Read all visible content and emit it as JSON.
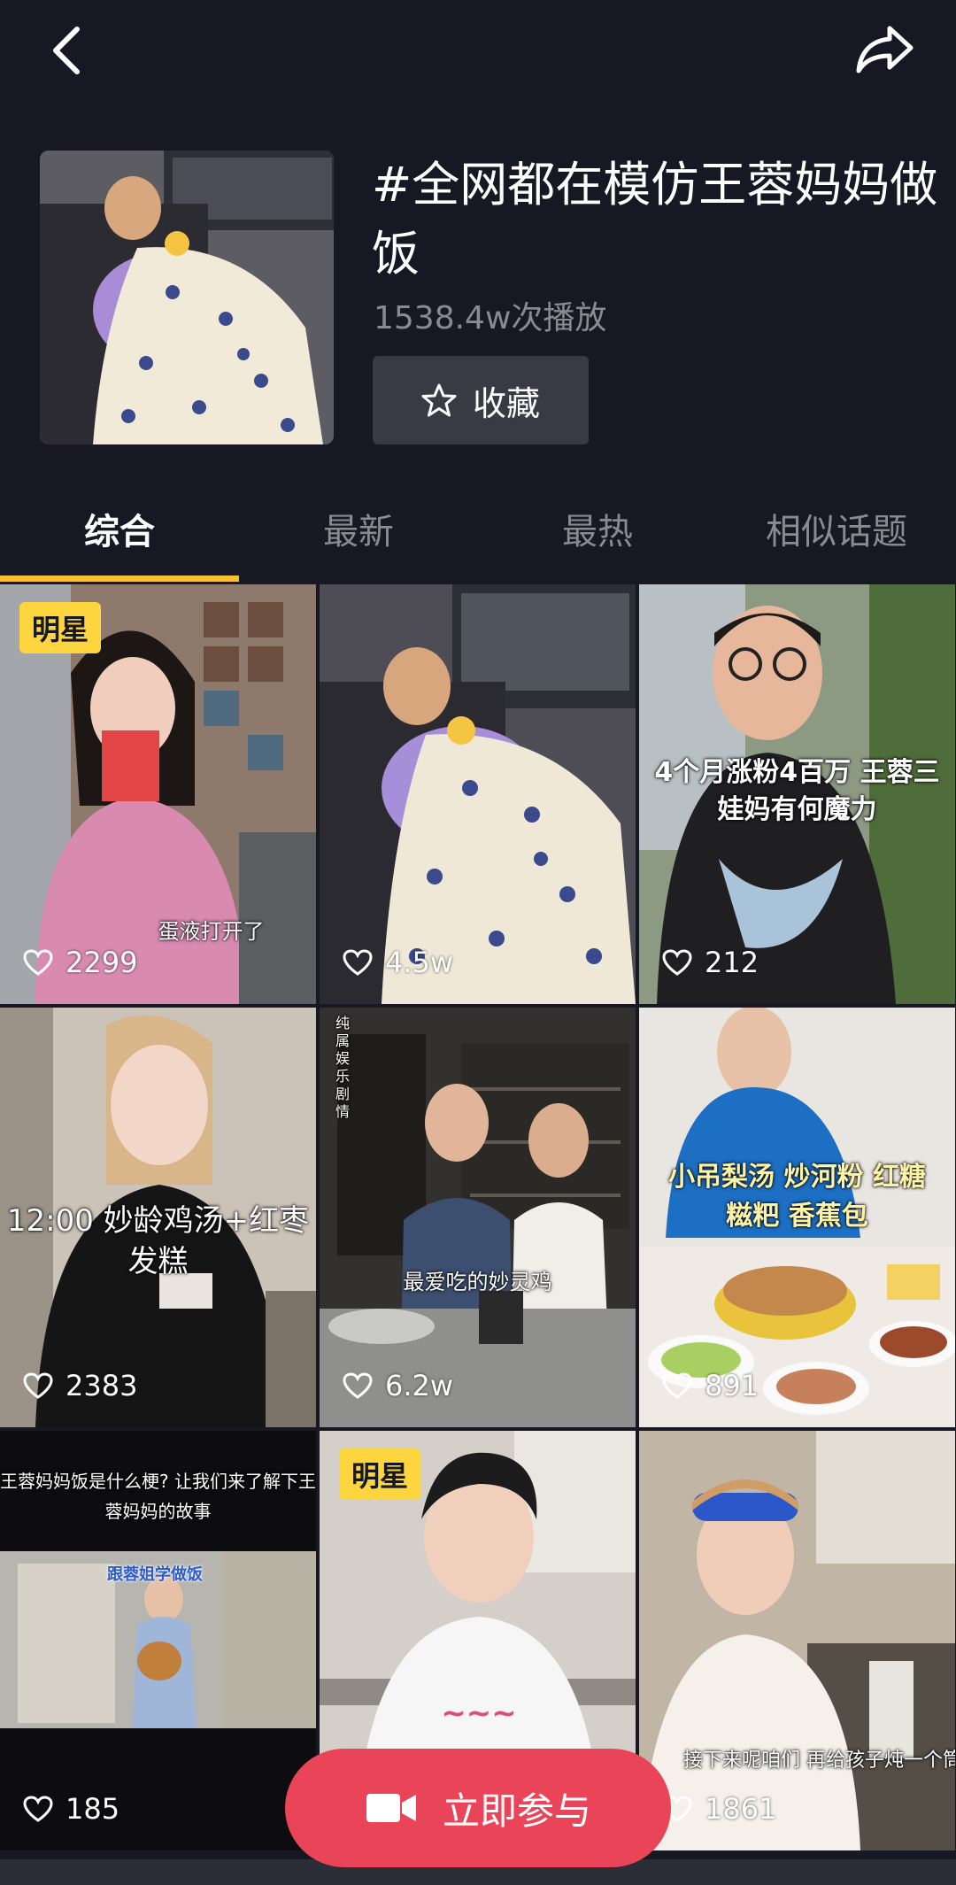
{
  "topbar": {
    "back_icon": "chevron-left-icon",
    "share_icon": "share-arrow-icon"
  },
  "topic": {
    "title": "#全网都在模仿王蓉妈妈做饭",
    "plays": "1538.4w次播放",
    "favorite_label": "收藏"
  },
  "tabs": [
    {
      "label": "综合",
      "active": true
    },
    {
      "label": "最新",
      "active": false
    },
    {
      "label": "最热",
      "active": false
    },
    {
      "label": "相似话题",
      "active": false
    }
  ],
  "videos": [
    {
      "likes": "2299",
      "badge": "明星",
      "caption": "蛋液打开了"
    },
    {
      "likes": "4.5w",
      "badge": "",
      "caption": ""
    },
    {
      "likes": "212",
      "badge": "",
      "caption": "4个月涨粉4百万 王蓉三娃妈有何魔力"
    },
    {
      "likes": "2383",
      "badge": "",
      "caption": "12:00 妙龄鸡汤+红枣发糕"
    },
    {
      "likes": "6.2w",
      "badge": "",
      "caption": "最爱吃的妙灵鸡",
      "side_text": "纯属娱乐剧情"
    },
    {
      "likes": "891",
      "badge": "",
      "caption": "小吊梨汤 炒河粉 红糖糍粑 香蕉包"
    },
    {
      "likes": "185",
      "badge": "",
      "caption": "王蓉妈妈饭是什么梗? 让我们来了解下王蓉妈妈的故事",
      "sub_caption": "跟蓉姐学做饭"
    },
    {
      "likes": "",
      "badge": "明星",
      "caption": ""
    },
    {
      "likes": "1861",
      "badge": "",
      "caption": "接下来呢咱们 再给孩子炖一个筒骨"
    }
  ],
  "join_button": {
    "label": "立即参与",
    "icon": "video-camera-icon"
  },
  "colors": {
    "background": "#161823",
    "accent_tab": "#fbc02d",
    "badge": "#fcd53f",
    "join_button": "#ea4458",
    "secondary_text": "#8a8b91"
  }
}
